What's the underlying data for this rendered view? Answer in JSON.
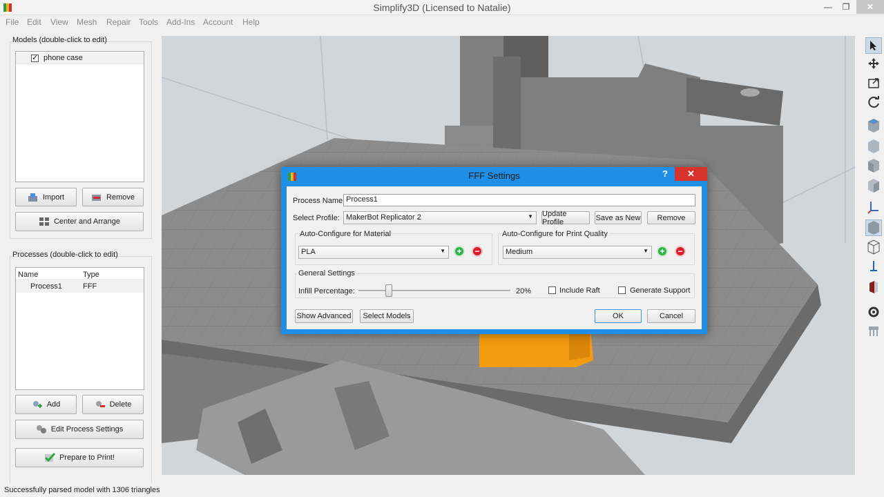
{
  "window": {
    "title": "Simplify3D (Licensed to Natalie)",
    "minimize": "—",
    "restore": "❐",
    "close": "✕"
  },
  "menu": [
    "File",
    "Edit",
    "View",
    "Mesh",
    "Repair",
    "Tools",
    "Add-Ins",
    "Account",
    "Help"
  ],
  "models": {
    "title": "Models (double-click to edit)",
    "items": [
      {
        "label": "phone case",
        "checked": true
      }
    ],
    "import_label": "Import",
    "remove_label": "Remove",
    "center_label": "Center and Arrange"
  },
  "processes": {
    "title": "Processes (double-click to edit)",
    "col_name": "Name",
    "col_type": "Type",
    "rows": [
      {
        "name": "Process1",
        "type": "FFF"
      }
    ],
    "add_label": "Add",
    "delete_label": "Delete",
    "edit_label": "Edit Process Settings",
    "prepare_label": "Prepare to Print!"
  },
  "status": "Successfully parsed model with 1306 triangles",
  "dialog": {
    "title": "FFF Settings",
    "help": "?",
    "close": "✕",
    "process_name_label": "Process Name:",
    "process_name_value": "Process1",
    "select_profile_label": "Select Profile:",
    "select_profile_value": "MakerBot Replicator 2",
    "update_profile": "Update Profile",
    "save_as_new": "Save as New",
    "remove": "Remove",
    "material_group": "Auto-Configure for Material",
    "material_value": "PLA",
    "quality_group": "Auto-Configure for Print Quality",
    "quality_value": "Medium",
    "general_group": "General Settings",
    "infill_label": "Infill Percentage:",
    "infill_value": "20%",
    "infill_fraction": 0.2,
    "include_raft": "Include Raft",
    "generate_support": "Generate Support",
    "show_advanced": "Show Advanced",
    "select_models": "Select Models",
    "ok": "OK",
    "cancel": "Cancel"
  },
  "colors": {
    "dialog_border": "#1e8ee6",
    "close_red": "#d9332d",
    "model_orange": "#f39c12",
    "printer_gray": "#8e8e8e"
  }
}
